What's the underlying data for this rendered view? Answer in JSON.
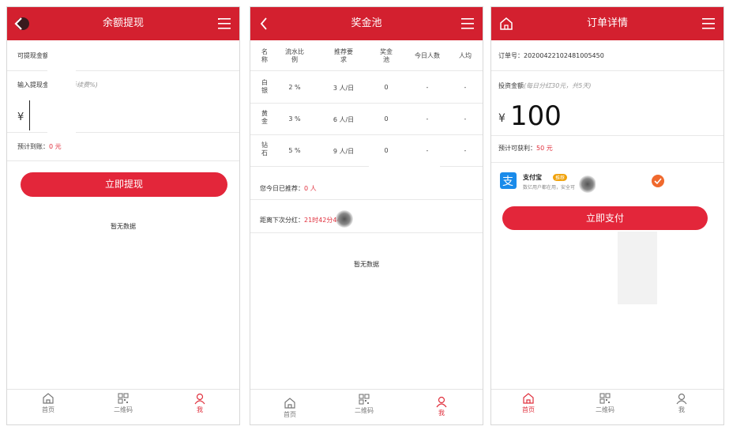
{
  "tabbar": {
    "home": "首页",
    "qrcode": "二维码",
    "me": "我"
  },
  "p1": {
    "title": "余额提现",
    "available_label": "可提现金额：",
    "available_value": "0 元",
    "input_label": "输入提现金额",
    "input_hint": "(提现手续费%)",
    "currency": "¥",
    "expected_label": "预计到账：",
    "expected_value": "0 元",
    "submit_label": "立即提现",
    "empty_text": "暂无数据"
  },
  "p2": {
    "title": "奖金池",
    "headers": [
      "名\n称",
      "流水比\n例",
      "推荐要\n求",
      "奖金\n池",
      "今日人数",
      "人均"
    ],
    "rows": [
      {
        "name": "白\n银",
        "ratio": "2 %",
        "req": "3 人/日",
        "pool": "0",
        "today": "-",
        "avg": "-"
      },
      {
        "name": "黄\n金",
        "ratio": "3 %",
        "req": "6 人/日",
        "pool": "0",
        "today": "-",
        "avg": "-"
      },
      {
        "name": "钻\n石",
        "ratio": "5 %",
        "req": "9 人/日",
        "pool": "0",
        "today": "-",
        "avg": "-"
      }
    ],
    "referred_label": "您今日已推荐：",
    "referred_value": "0 人",
    "next_label": "距离下次分红：",
    "next_value": "21时42分44秒",
    "empty_text": "暂无数据"
  },
  "p3": {
    "title": "订单详情",
    "order_label": "订单号：",
    "order_no": "20200422102481005450",
    "invest_label": "投资金额",
    "invest_hint": "(每日分红30元，共5天)",
    "amount_currency": "¥",
    "amount_value": "100",
    "expected_label": "预计可获利：",
    "expected_value": "50 元",
    "pay_name": "支付宝",
    "pay_badge": "推荐",
    "pay_desc": "数亿用户都在用，安全可",
    "submit_label": "立即支付"
  },
  "colors": {
    "brand": "#d3202f",
    "button": "#e3263a",
    "accent_orange": "#f0692d",
    "alipay": "#1a8bea"
  }
}
